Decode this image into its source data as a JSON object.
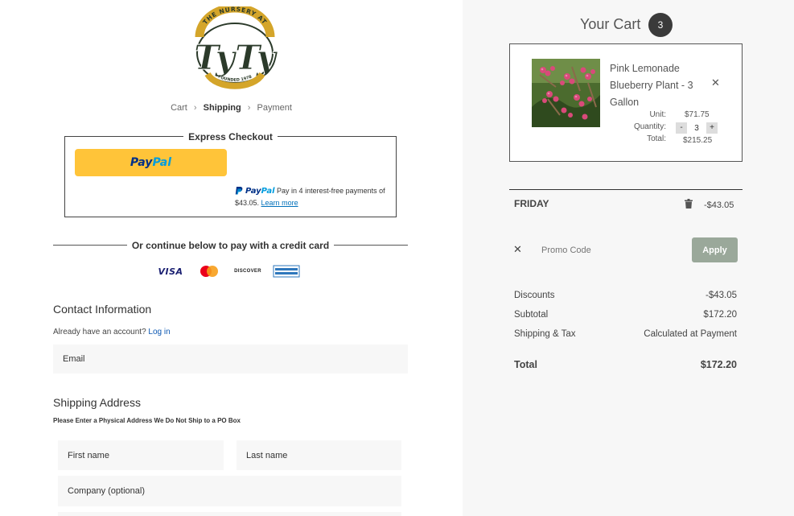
{
  "logo": {
    "arc_text": "THE NURSERY AT",
    "brand_text": "TyTy",
    "bottom_text": "FOUNDED 1978"
  },
  "breadcrumb": [
    "Cart",
    "Shipping",
    "Payment"
  ],
  "express": {
    "title": "Express Checkout",
    "paypal_pay": "Pay",
    "paypal_pal": "Pal",
    "paylater_text": "Pay in 4 interest-free payments of $43.05.",
    "paylater_link": "Learn more"
  },
  "divider_text": "Or continue below to pay with a credit card",
  "cards": {
    "visa": "VISA",
    "discover": "DISCOVER"
  },
  "contact": {
    "title": "Contact Information",
    "account_text": "Already have an account?",
    "login_link": "Log in",
    "email_placeholder": "Email"
  },
  "shipping": {
    "title": "Shipping Address",
    "note": "Please Enter a Physical Address We Do Not Ship to a PO Box",
    "first_name": "First name",
    "last_name": "Last name",
    "company": "Company (optional)"
  },
  "cart": {
    "title": "Your Cart",
    "count": "3",
    "item": {
      "name": "Pink Lemonade Blueberry Plant - 3 Gallon",
      "unit_label": "Unit:",
      "unit_value": "$71.75",
      "qty_label": "Quantity:",
      "qty_value": "3",
      "total_label": "Total:",
      "total_value": "$215.25",
      "minus": "-",
      "plus": "+"
    },
    "discount_code": "FRIDAY",
    "discount_code_amount": "-$43.05",
    "promo_placeholder": "Promo Code",
    "apply": "Apply",
    "summary": {
      "discounts_label": "Discounts",
      "discounts_value": "-$43.05",
      "subtotal_label": "Subtotal",
      "subtotal_value": "$172.20",
      "shipping_label": "Shipping & Tax",
      "shipping_value": "Calculated at Payment",
      "total_label": "Total",
      "total_value": "$172.20"
    }
  },
  "colors": {
    "paypal_yellow": "#ffc439",
    "apply_green": "#9aa89a",
    "logo_gold": "#d4a52a",
    "logo_dark": "#2b3a2a"
  }
}
